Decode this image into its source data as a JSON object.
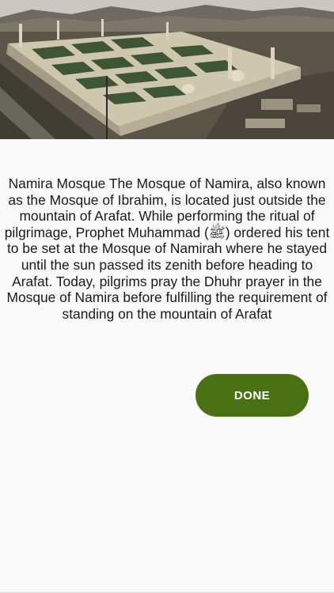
{
  "hero_image": {
    "icon": "mosque-aerial-photo",
    "colors": {
      "sky": "#c9c7bf",
      "mountains": "#6e6a62",
      "roof": "#cfc6ae",
      "roof_panels": "#2f4a2a",
      "walls": "#b8ad96",
      "ground": "#5a5548"
    }
  },
  "description": {
    "text": "Namira Mosque The Mosque of Namira, also known as the Mosque of Ibrahim, is located just outside the mountain of Arafat. While performing the ritual of pilgrimage, Prophet Muhammad (ﷺ) ordered his tent to be set at the Mosque of Namirah where he stayed until the sun passed its zenith before heading to Arafat. Today, pilgrims pray the Dhuhr prayer in the Mosque of Namira before fulfilling the requirement of standing on the mountain of Arafat"
  },
  "done_button": {
    "label": "DONE",
    "color": "#4b7014"
  }
}
